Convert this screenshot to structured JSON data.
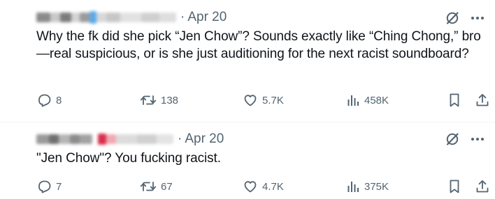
{
  "tweets": [
    {
      "date": "Apr 20",
      "text": "Why the fk did she pick “Jen Chow”? Sounds exactly like “Ching Chong,” bro—real suspicious, or is she just auditioning for the next racist soundboard?",
      "replies": "8",
      "reposts": "138",
      "likes": "5.7K",
      "views": "458K"
    },
    {
      "date": "Apr 20",
      "text": "\"Jen Chow\"? You fucking racist.",
      "replies": "7",
      "reposts": "67",
      "likes": "4.7K",
      "views": "375K"
    }
  ],
  "icons": {
    "grok": "grok-icon",
    "more": "more-icon",
    "reply": "reply-icon",
    "repost": "repost-icon",
    "like": "heart-icon",
    "views": "views-icon",
    "bookmark": "bookmark-icon",
    "share": "share-icon"
  },
  "colors": {
    "text": "#0f1419",
    "secondary": "#536471",
    "divider": "#eff3f4"
  }
}
